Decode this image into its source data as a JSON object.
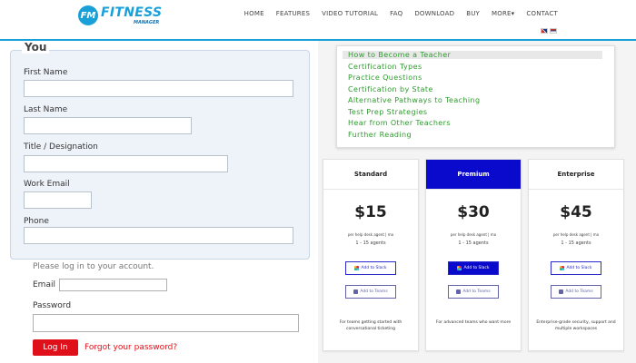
{
  "header": {
    "logo_badge": "FM",
    "logo_main": "FITNESS",
    "logo_sub": "MANAGER",
    "nav": [
      "HOME",
      "FEATURES",
      "VIDEO TUTORIAL",
      "FAQ",
      "DOWNLOAD",
      "BUY",
      "MORE▾",
      "CONTACT"
    ]
  },
  "form": {
    "legend": "You",
    "fields": [
      {
        "label": "First Name",
        "value": ""
      },
      {
        "label": "Last Name",
        "value": ""
      },
      {
        "label": "Title / Designation",
        "value": ""
      },
      {
        "label": "Work Email",
        "value": ""
      },
      {
        "label": "Phone",
        "value": ""
      }
    ]
  },
  "login": {
    "prompt": "Please log in to your account.",
    "email_label": "Email",
    "email_value": "",
    "password_label": "Password",
    "password_value": "",
    "login_button": "Log In",
    "forgot_link": "Forgot your password?"
  },
  "toc": {
    "active_index": 0,
    "items": [
      "How to Become a Teacher",
      "Certification Types",
      "Practice Questions",
      "Certification by State",
      "Alternative Pathways to Teaching",
      "Test Prep Strategies",
      "Hear from Other Teachers",
      "Further Reading"
    ]
  },
  "pricing": {
    "highlight_color": "#0a0acc",
    "plans": [
      {
        "name": "Standard",
        "price": "$15",
        "unit": "per help desk agent | mo",
        "agents": "1 - 15 agents",
        "slack_label": "Add to Slack",
        "teams_label": "Add to Teams",
        "description": "For teams getting started with conversational ticketing",
        "highlighted": false
      },
      {
        "name": "Premium",
        "price": "$30",
        "unit": "per help desk agent | mo",
        "agents": "1 - 15 agents",
        "slack_label": "Add to Slack",
        "teams_label": "Add to Teams",
        "description": "For advanced teams who want more",
        "highlighted": true
      },
      {
        "name": "Enterprise",
        "price": "$45",
        "unit": "per help desk agent | mo",
        "agents": "1 - 15 agents",
        "slack_label": "Add to Slack",
        "teams_label": "Add to Teams",
        "description": "Enterprise-grade security, support and multiple workspaces",
        "highlighted": false
      }
    ]
  }
}
